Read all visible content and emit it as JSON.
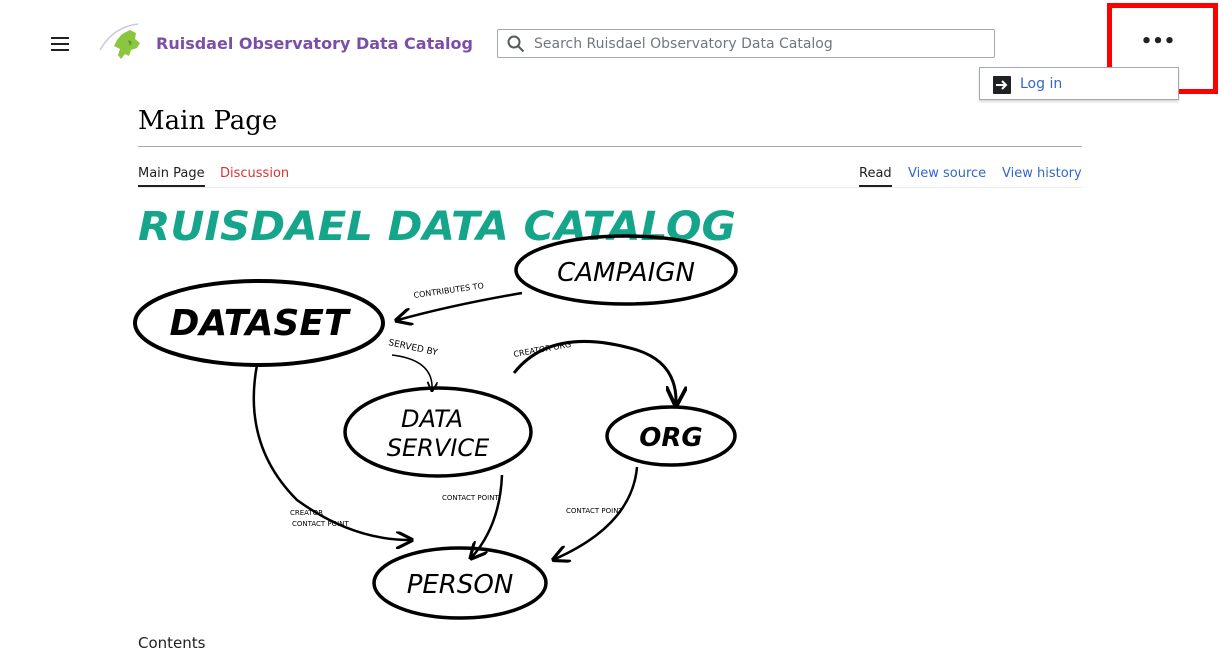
{
  "header": {
    "site_title": "Ruisdael Observatory Data Catalog",
    "search_placeholder": "Search Ruisdael Observatory Data Catalog",
    "more_label": "•••",
    "login_label": "Log in"
  },
  "page": {
    "title": "Main Page",
    "tabs_left": [
      "Main Page",
      "Discussion"
    ],
    "tabs_right": [
      "Read",
      "View source",
      "View history"
    ],
    "contents_label": "Contents"
  },
  "diagram": {
    "heading": "RUISDAEL DATA CATALOG",
    "nodes": [
      "DATASET",
      "CAMPAIGN",
      "DATA",
      "SERVICE",
      "ORG",
      "PERSON"
    ],
    "edges": [
      "CONTRIBUTES TO",
      "SERVED BY",
      "CREATOR ORG",
      "CONTACT POINT",
      "CONTACT POINT",
      "CREATOR",
      "CONTACT POINT"
    ]
  },
  "colors": {
    "brand": "#7b4fa8",
    "link": "#3366cc",
    "new_link": "#d73333",
    "heading_green": "#14a58a",
    "highlight": "#ff0000"
  },
  "icons": [
    "menu-icon",
    "logo-icon",
    "search-icon",
    "login-icon"
  ]
}
